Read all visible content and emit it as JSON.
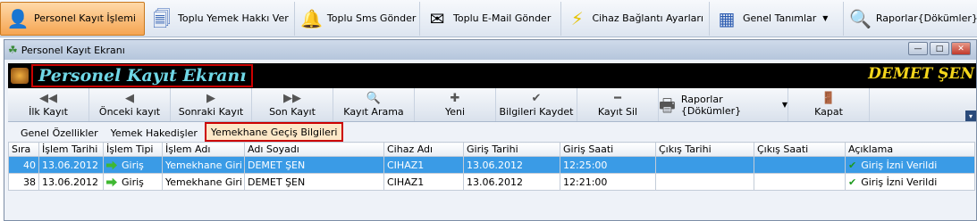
{
  "toolbar": {
    "items": [
      {
        "label": "Personel Kayıt İşlemi",
        "icon": "user-card-icon"
      },
      {
        "label": "Toplu Yemek Hakkı Ver",
        "icon": "documents-arrow-icon"
      },
      {
        "label": "Toplu Sms Gönder",
        "icon": "bell-icon"
      },
      {
        "label": "Toplu E-Mail Gönder",
        "icon": "envelope-icon"
      },
      {
        "label": "Cihaz Bağlantı Ayarları",
        "icon": "lightning-icon"
      },
      {
        "label": "Genel Tanımlar",
        "icon": "calendar-grid-icon"
      },
      {
        "label": "Raporlar{Dökümler}",
        "icon": "report-magnifier-icon"
      }
    ]
  },
  "window": {
    "title": "Personel Kayıt Ekranı",
    "header_title": "Personel Kayıt Ekranı",
    "user_name": "DEMET ŞEN"
  },
  "actions": [
    {
      "label": "İlk Kayıt",
      "icon": "first-record-icon"
    },
    {
      "label": "Önceki kayıt",
      "icon": "previous-record-icon"
    },
    {
      "label": "Sonraki Kayıt",
      "icon": "next-record-icon"
    },
    {
      "label": "Son Kayıt",
      "icon": "last-record-icon"
    },
    {
      "label": "Kayıt Arama",
      "icon": "search-record-icon"
    },
    {
      "label": "Yeni",
      "icon": "plus-icon"
    },
    {
      "label": "Bilgileri Kaydet",
      "icon": "checkmark-icon"
    },
    {
      "label": "Kayıt Sil",
      "icon": "minus-icon"
    },
    {
      "label": "Raporlar {Dökümler}",
      "icon": "printer-icon"
    },
    {
      "label": "Kapat",
      "icon": "exit-door-icon"
    }
  ],
  "tabs": [
    "Genel Özellikler",
    "Yemek Hakedişler",
    "Yemekhane Geçiş Bilgileri"
  ],
  "grid": {
    "columns": [
      "Sıra",
      "İşlem Tarihi",
      "İşlem Tipi",
      "İşlem Adı",
      "Adı Soyadı",
      "Cihaz Adı",
      "Giriş Tarihi",
      "Giriş Saati",
      "Çıkış Tarihi",
      "Çıkış Saati",
      "Açıklama"
    ],
    "rows": [
      {
        "sira": "40",
        "islem_tarihi": "13.06.2012",
        "islem_tipi": "Giriş",
        "islem_adi": "Yemekhane Giri",
        "adi_soyadi": "DEMET ŞEN",
        "cihaz_adi": "CIHAZ1",
        "giris_tarihi": "13.06.2012",
        "giris_saati": "12:25:00",
        "cikis_tarihi": "",
        "cikis_saati": "",
        "aciklama": "Giriş İzni Verildi"
      },
      {
        "sira": "38",
        "islem_tarihi": "13.06.2012",
        "islem_tipi": "Giriş",
        "islem_adi": "Yemekhane Giri",
        "adi_soyadi": "DEMET ŞEN",
        "cihaz_adi": "CIHAZ1",
        "giris_tarihi": "13.06.2012",
        "giris_saati": "12:21:00",
        "cikis_tarihi": "",
        "cikis_saati": "",
        "aciklama": "Giriş İzni Verildi"
      }
    ]
  }
}
